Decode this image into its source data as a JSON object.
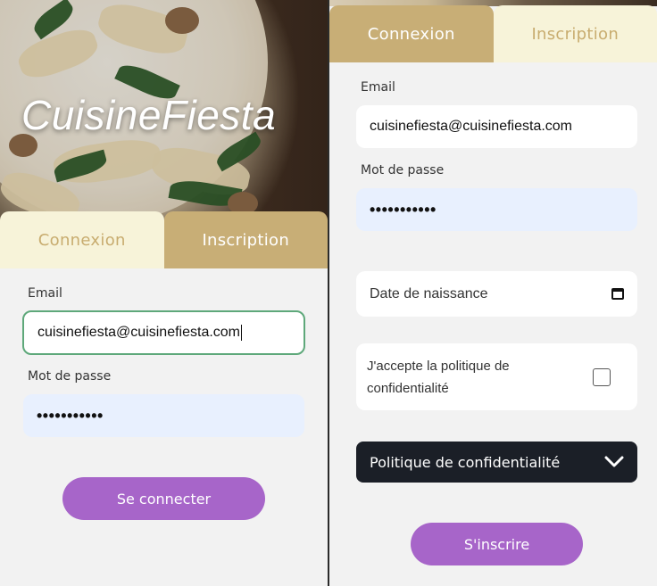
{
  "left_panel": {
    "brand": "CuisineFiesta",
    "tabs": {
      "login": "Connexion",
      "signup": "Inscription"
    },
    "email_label": "Email",
    "email_value": "cuisinefiesta@cuisinefiesta.com",
    "password_label": "Mot de passe",
    "password_value": "•••••••••••",
    "submit_label": "Se connecter"
  },
  "right_panel": {
    "tabs": {
      "login": "Connexion",
      "signup": "Inscription"
    },
    "email_label": "Email",
    "email_value": "cuisinefiesta@cuisinefiesta.com",
    "password_label": "Mot de passe",
    "password_value": "•••••••••••",
    "birthdate_placeholder": "Date de naissance",
    "privacy_accept": "J'accepte la politique de confidentialité",
    "privacy_dropdown": "Politique de confidentialité",
    "submit_label": "S'inscrire"
  },
  "colors": {
    "accent": "#a765c9",
    "tab_gold": "#c8ae76",
    "tab_light": "#f7f3d9",
    "dropdown_bg": "#1b1f27",
    "focus_border": "#5ea87a"
  },
  "icons": [
    "calendar-icon",
    "chevron-down-icon"
  ]
}
